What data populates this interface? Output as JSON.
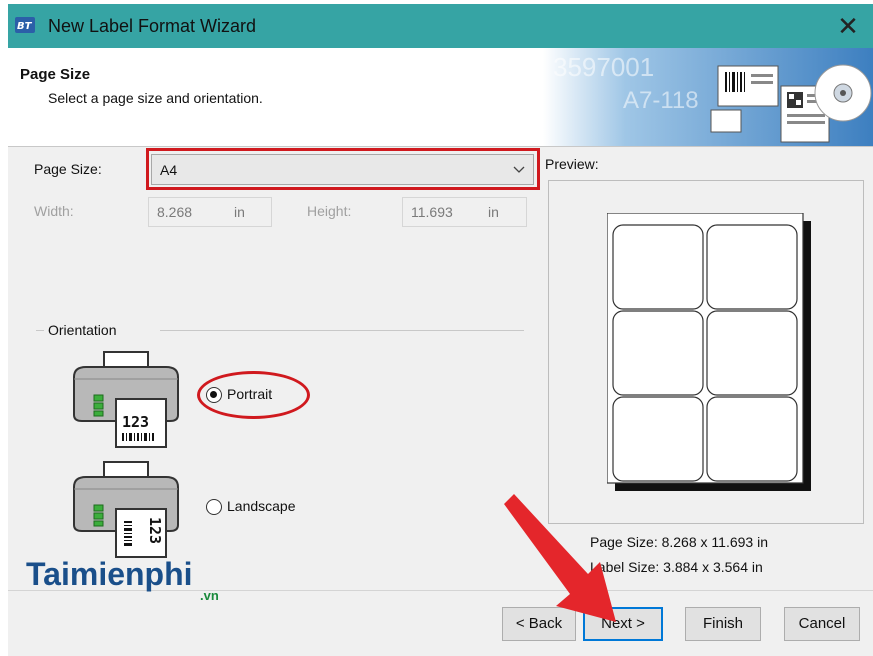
{
  "window": {
    "title": "New Label Format Wizard",
    "close_glyph": "✕"
  },
  "header": {
    "title": "Page Size",
    "subtitle": "Select a page size and orientation.",
    "art_icon": "barcode-labels-art",
    "art_text_1": "3597001",
    "art_text_2": "A7-118"
  },
  "page_size": {
    "label": "Page Size:",
    "value": "A4"
  },
  "dimensions": {
    "width_label": "Width:",
    "width_value": "8.268",
    "width_unit": "in",
    "height_label": "Height:",
    "height_value": "11.693",
    "height_unit": "in"
  },
  "orientation": {
    "group_label": "Orientation",
    "portrait_label": "Portrait",
    "landscape_label": "Landscape",
    "selected": "Portrait",
    "printer_text": "123"
  },
  "preview": {
    "label": "Preview:",
    "page_size_text": "Page Size:  8.268 x 11.693 in",
    "label_size_text": "Label Size:  3.884 x 3.564 in"
  },
  "buttons": {
    "back": "< Back",
    "next": "Next >",
    "finish": "Finish",
    "cancel": "Cancel"
  },
  "watermark": {
    "main": "Taimienphi",
    "sub": ".vn"
  },
  "colors": {
    "titlebar": "#36a4a4",
    "highlight": "#d0191e",
    "focus": "#0078d7"
  }
}
